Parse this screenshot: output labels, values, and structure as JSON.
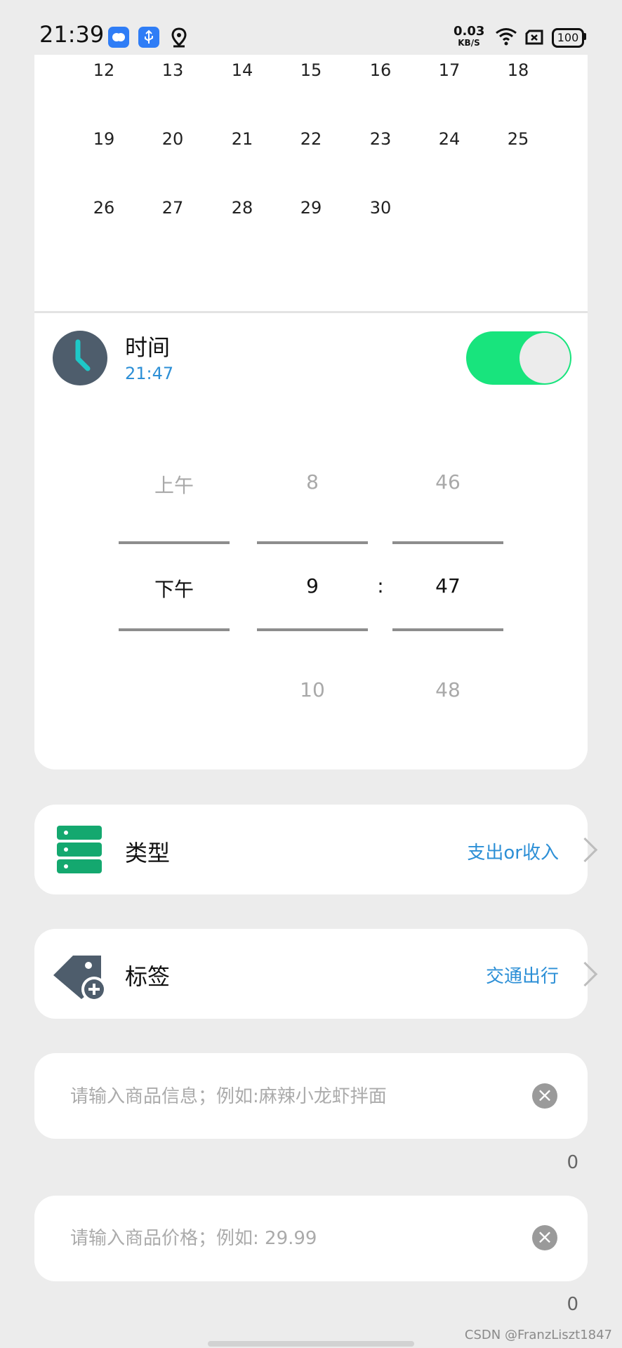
{
  "status_bar": {
    "time": "21:39",
    "net_speed": "0.03",
    "net_unit": "KB/S",
    "battery": "100",
    "icons": [
      "cloud-app-icon",
      "usb-icon",
      "location-icon",
      "wifi-icon",
      "sim-off-icon",
      "battery-icon"
    ]
  },
  "calendar": {
    "weeks": [
      [
        "12",
        "13",
        "14",
        "15",
        "16",
        "17",
        "18"
      ],
      [
        "19",
        "20",
        "21",
        "22",
        "23",
        "24",
        "25"
      ],
      [
        "26",
        "27",
        "28",
        "29",
        "30"
      ]
    ]
  },
  "time_section": {
    "title": "时间",
    "value": "21:47",
    "toggle_on": true,
    "picker": {
      "ampm": {
        "prev": "上午",
        "selected": "下午",
        "next": ""
      },
      "hour": {
        "prev": "8",
        "selected": "9",
        "next": "10"
      },
      "separator": ":",
      "minute": {
        "prev": "46",
        "selected": "47",
        "next": "48"
      }
    }
  },
  "type_row": {
    "label": "类型",
    "value": "支出or收入"
  },
  "tag_row": {
    "label": "标签",
    "value": "交通出行"
  },
  "goods_input": {
    "placeholder": "请输入商品信息；例如:麻辣小龙虾拌面",
    "value": "",
    "counter": "0"
  },
  "price_input": {
    "placeholder": "请输入商品价格；例如: 29.99",
    "value": "",
    "counter": "0"
  },
  "watermark": "CSDN @FranzLiszt1847",
  "colors": {
    "accent_blue": "#2c8fd6",
    "toggle_green": "#18e47d",
    "type_icon_green": "#14a86f",
    "icon_slate": "#4e5d6c",
    "clock_hand": "#1ec8c8"
  }
}
